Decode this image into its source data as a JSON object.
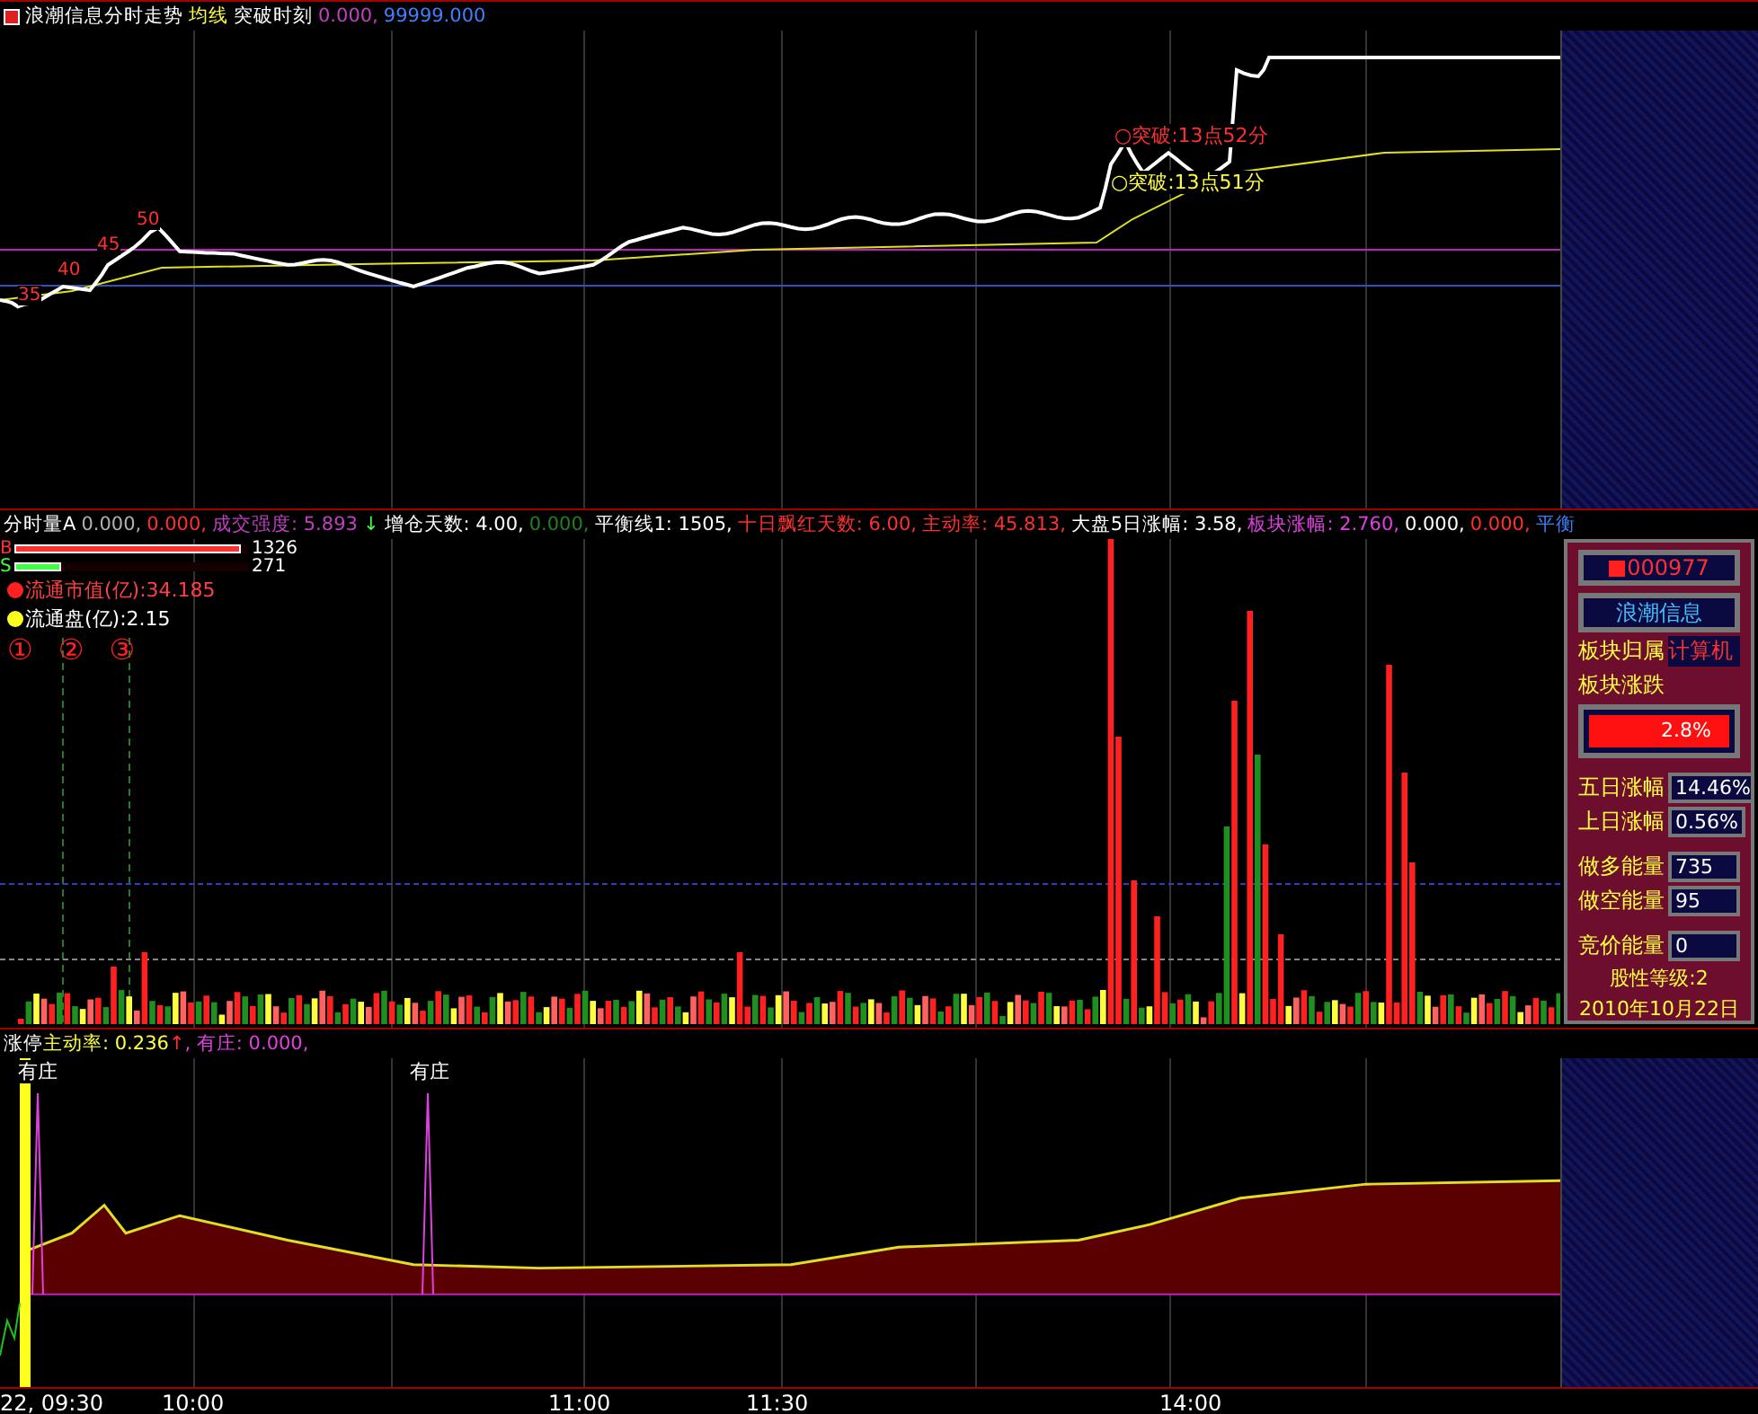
{
  "price_panel": {
    "header": [
      {
        "text": "浪潮信息分时走势",
        "color": "#ffffff"
      },
      {
        "text": "均线",
        "color": "#ffff40"
      },
      {
        "text": "突破时刻",
        "color": "#ffffff"
      },
      {
        "text": "0.000,",
        "color": "#c040c0"
      },
      {
        "text": "99999.000",
        "color": "#4080ff"
      }
    ],
    "markers": [
      "35",
      "40",
      "45",
      "50"
    ],
    "annotations": [
      {
        "text": "○突破:13点52分",
        "color": "#ff3030"
      },
      {
        "text": "○突破:13点51分",
        "color": "#ffff40"
      }
    ]
  },
  "volume_panel": {
    "header": [
      {
        "text": "分时量A",
        "color": "#ffffff"
      },
      {
        "text": "0.000,",
        "color": "#b0b0b0"
      },
      {
        "text": "0.000,",
        "color": "#ff3030"
      },
      {
        "text": "成交强度: 5.893",
        "color": "#c040c0"
      },
      {
        "text": "↓",
        "color": "#40ff40"
      },
      {
        "text": "增仓天数: 4.00,",
        "color": "#ffffff"
      },
      {
        "text": "0.000,",
        "color": "#208020"
      },
      {
        "text": "平衡线1: 1505,",
        "color": "#ffffff"
      },
      {
        "text": "十日飘红天数: 6.00,",
        "color": "#ff3030"
      },
      {
        "text": "主动率: 45.813,",
        "color": "#ff3030"
      },
      {
        "text": "大盘5日涨幅: 3.58,",
        "color": "#ffffff"
      },
      {
        "text": "板块涨幅: 2.760,",
        "color": "#e040e0"
      },
      {
        "text": "0.000,",
        "color": "#ffffff"
      },
      {
        "text": "0.000,",
        "color": "#ff3030"
      },
      {
        "text": "平衡",
        "color": "#4080ff"
      }
    ],
    "bars": [
      {
        "label": "B",
        "value": "1326",
        "color": "#ff3030",
        "level": 0.97
      },
      {
        "label": "S",
        "value": "271",
        "color": "#40ff40",
        "level": 0.2
      }
    ],
    "legend": [
      {
        "text": "流通市值(亿):34.185",
        "color": "#ff2020"
      },
      {
        "text": "流通盘(亿):2.15",
        "color": "#ffff20"
      }
    ],
    "circled": [
      "①",
      "②",
      "③"
    ]
  },
  "side_panel": {
    "code": "000977",
    "name": "浪潮信息",
    "sector_label": "板块归属",
    "sector": "计算机",
    "change_label": "板块涨跌",
    "change": "2.8%",
    "stats": [
      {
        "label": "五日涨幅",
        "value": "14.46%"
      },
      {
        "label": "上日涨幅",
        "value": "0.56%"
      },
      {
        "label": "做多能量",
        "value": "735"
      },
      {
        "label": "做空能量",
        "value": "95"
      },
      {
        "label": "竞价能量",
        "value": "0"
      }
    ],
    "grade": "股性等级:2",
    "date": "2010年10月22日"
  },
  "lower_panel": {
    "header": [
      {
        "text": "涨停",
        "color": "#ffffff"
      },
      {
        "text": "主动率: 0.236",
        "color": "#ffff40"
      },
      {
        "text": "↑",
        "color": "#ff3030"
      },
      {
        "text": ", 有庄: 0.000,",
        "color": "#e040e0"
      }
    ],
    "markers": [
      "有庄",
      "有庄"
    ]
  },
  "time_axis": [
    "22, 09:30",
    "10:00",
    "11:00",
    "11:30",
    "14:00"
  ]
}
